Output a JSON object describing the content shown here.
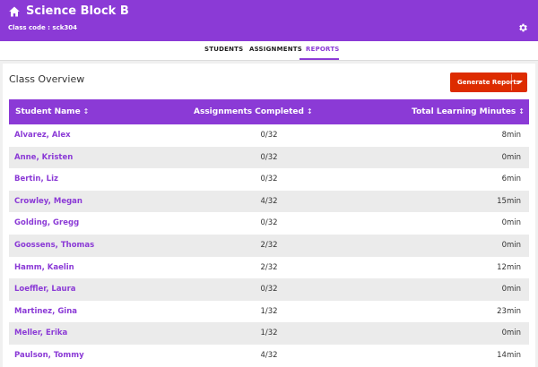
{
  "header": {
    "title": "Science Block B",
    "class_code": "Class code : sck304",
    "home_icon": "home-icon",
    "settings_icon": "gear-icon",
    "color": "#8b3ad6"
  },
  "tabs": [
    {
      "label": "STUDENTS",
      "active": false
    },
    {
      "label": "ASSIGNMENTS",
      "active": false
    },
    {
      "label": "REPORTS",
      "active": true
    }
  ],
  "main": {
    "title": "Class Overview",
    "generate_button": "Generate Reports",
    "generate_color": "#dd2c00",
    "columns": [
      "Student Name",
      "Assignments Completed",
      "Total Learning Minutes"
    ],
    "rows": [
      {
        "name": "Alvarez, Alex",
        "assignments": "0/32",
        "minutes": "8min"
      },
      {
        "name": "Anne, Kristen",
        "assignments": "0/32",
        "minutes": "0min"
      },
      {
        "name": "Bertin, Liz",
        "assignments": "0/32",
        "minutes": "6min"
      },
      {
        "name": "Crowley, Megan",
        "assignments": "4/32",
        "minutes": "15min"
      },
      {
        "name": "Golding, Gregg",
        "assignments": "0/32",
        "minutes": "0min"
      },
      {
        "name": "Goossens, Thomas",
        "assignments": "2/32",
        "minutes": "0min"
      },
      {
        "name": "Hamm, Kaelin",
        "assignments": "2/32",
        "minutes": "12min"
      },
      {
        "name": "Loeffler, Laura",
        "assignments": "0/32",
        "minutes": "0min"
      },
      {
        "name": "Martinez, Gina",
        "assignments": "1/32",
        "minutes": "23min"
      },
      {
        "name": "Meller, Erika",
        "assignments": "1/32",
        "minutes": "0min"
      },
      {
        "name": "Paulson, Tommy",
        "assignments": "4/32",
        "minutes": "14min"
      }
    ]
  }
}
